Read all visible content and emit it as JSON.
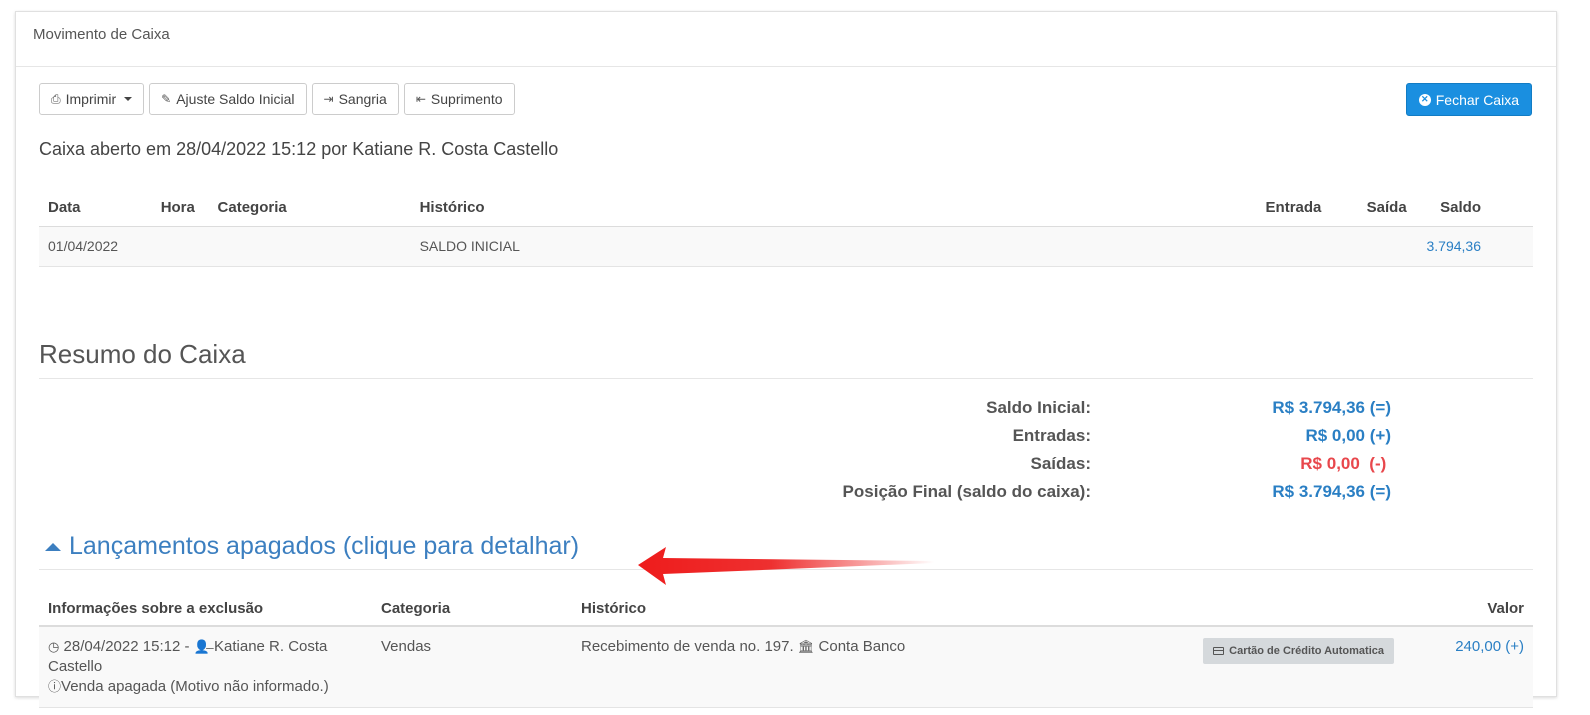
{
  "panel": {
    "title": "Movimento de Caixa"
  },
  "toolbar": {
    "print_label": "Imprimir",
    "adjust_label": "Ajuste Saldo Inicial",
    "bleed_label": "Sangria",
    "supply_label": "Suprimento",
    "close_label": "Fechar Caixa"
  },
  "opened_text": "Caixa aberto em 28/04/2022 15:12 por Katiane R. Costa Castello",
  "movements": {
    "headers": [
      "Data",
      "Hora",
      "Categoria",
      "Histórico",
      "Entrada",
      "Saída",
      "Saldo"
    ],
    "rows": [
      {
        "date": "01/04/2022",
        "time": "",
        "category": "",
        "history": "SALDO INICIAL",
        "in": "",
        "out": "",
        "balance": "3.794,36"
      }
    ]
  },
  "summary": {
    "title": "Resumo do Caixa",
    "rows": [
      {
        "label": "Saldo Inicial:",
        "value": "R$ 3.794,36",
        "sign": "(=)"
      },
      {
        "label": "Entradas:",
        "value": "R$ 0,00",
        "sign": "(+)"
      },
      {
        "label": "Saídas:",
        "value": "R$ 0,00",
        "sign": "(-)"
      },
      {
        "label": "Posição Final (saldo do caixa):",
        "value": "R$ 3.794,36",
        "sign": "(=)"
      }
    ]
  },
  "deleted": {
    "title": "Lançamentos apagados (clique para detalhar)",
    "headers": [
      "Informações sobre a exclusão",
      "Categoria",
      "Histórico",
      "Valor"
    ],
    "rows": [
      {
        "datetime": "28/04/2022 15:12 -",
        "user": "Katiane R. Costa Castello",
        "reason": "Venda apagada (Motivo não informado.)",
        "category": "Vendas",
        "history": "Recebimento de venda no. 197.",
        "account": "Conta Banco",
        "payment_badge": "Cartão de Crédito Automatica",
        "value": "240,00 (+)"
      }
    ]
  },
  "colors": {
    "primary": "#1a8fe0",
    "link_blue": "#2a7fc4",
    "negative_red": "#e8474c",
    "arrow_red": "#ee1c1c"
  }
}
